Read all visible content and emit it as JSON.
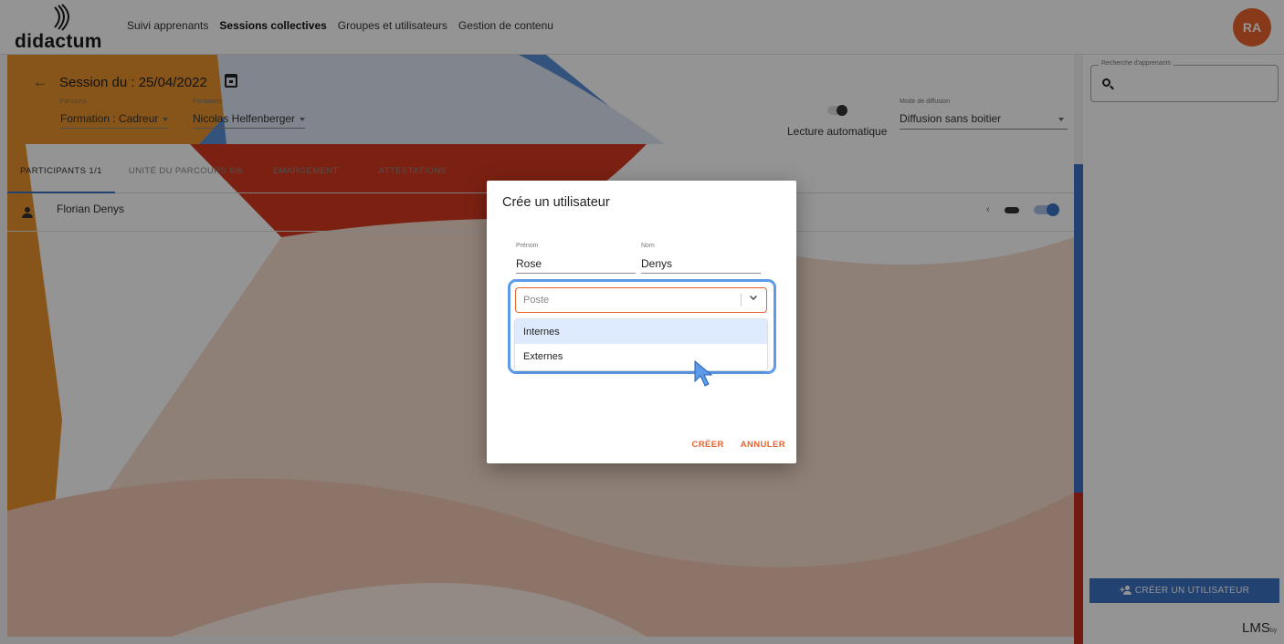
{
  "app": {
    "logo_text": "didactum",
    "nav": [
      {
        "label": "Suivi apprenants",
        "active": false
      },
      {
        "label": "Sessions collectives",
        "active": true
      },
      {
        "label": "Groupes et utilisateurs",
        "active": false
      },
      {
        "label": "Gestion de contenu",
        "active": false
      }
    ],
    "avatar_initials": "RA",
    "accent_color": "#e8622c",
    "primary_color": "#3b74c4"
  },
  "session": {
    "title": "Session du : 25/04/2022",
    "parcours_label": "Parcours",
    "parcours_value": "Formation : Cadreur",
    "formateur_label": "Formateur",
    "formateur_value": "Nicolas Helfenberger",
    "lecture_auto_label": "Lecture automatique",
    "diffusion_label": "Mode de diffusion",
    "diffusion_value": "Diffusion sans boitier"
  },
  "tabs": [
    {
      "label": "PARTICIPANTS 1/1",
      "active": true
    },
    {
      "label": "UNITÉ DU PARCOURS 6/6",
      "active": false
    },
    {
      "label": "EMARGEMENT",
      "active": false
    },
    {
      "label": "ATTESTATIONS",
      "active": false
    }
  ],
  "participants": [
    {
      "name": "Florian Denys"
    }
  ],
  "right_panel": {
    "search_legend": "Recherche d'apprenants",
    "create_user_label": "CRÉER UN UTILISATEUR",
    "brand": "LMS",
    "brand_by": "by"
  },
  "dialog": {
    "title": "Crée un utilisateur",
    "prenom_label": "Prénom",
    "prenom_value": "Rose",
    "nom_label": "Nom",
    "nom_value": "Denys",
    "poste_placeholder": "Poste",
    "poste_options": [
      "Internes",
      "Externes"
    ],
    "hovered_option": "Internes",
    "create_label": "CRÉER",
    "cancel_label": "ANNULER"
  }
}
